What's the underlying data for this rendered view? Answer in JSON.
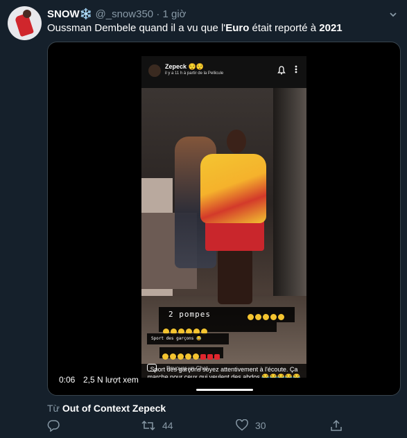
{
  "tweet": {
    "author_name": "SNOW❄️",
    "handle": "@_snow350",
    "separator": "·",
    "time": "1 giờ",
    "text_before": "Oussman Dembele quand il a vu que l'",
    "text_bold_1": "Euro",
    "text_middle": " était reporté à ",
    "text_bold_2": "2021"
  },
  "media": {
    "snap_username": "Zepeck 😌😌",
    "snap_subtitle": "il y a 11 h à partir de la Pellicule",
    "caption_1": "2 pompes",
    "caption_2": "Sport des garçons 😂",
    "caption_3": "Sport des garçons soyez attentivement à l'écoute. Ça marche pour ceux qui veulent des abdos 😂😂😂😂😂😂😂😂😂😂",
    "chat_placeholder": "Envoyer un Chat",
    "video_time": "0:06",
    "views": "2,5 N lượt xem"
  },
  "source": {
    "prefix": "Từ ",
    "name": "Out of Context Zepeck"
  },
  "actions": {
    "reply_icon": "reply-icon",
    "retweet_count": "44",
    "like_count": "30",
    "share_icon": "share-icon"
  },
  "colors": {
    "background": "#15202b",
    "muted": "#8899a6",
    "border": "#38444d"
  }
}
